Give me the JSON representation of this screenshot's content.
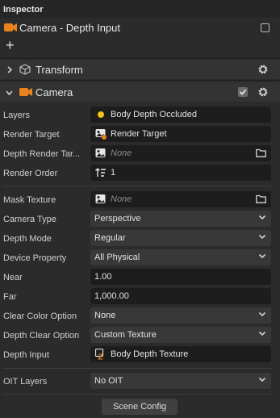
{
  "panel": {
    "title": "Inspector"
  },
  "object": {
    "name": "Camera - Depth Input",
    "add_label": "+"
  },
  "components": {
    "transform": {
      "label": "Transform"
    },
    "camera": {
      "label": "Camera"
    }
  },
  "properties": {
    "layers": {
      "label": "Layers",
      "value": "Body Depth Occluded"
    },
    "render_target": {
      "label": "Render Target",
      "value": "Render Target"
    },
    "depth_render_target": {
      "label": "Depth Render Tar...",
      "value": "None"
    },
    "render_order": {
      "label": "Render Order",
      "value": "1"
    },
    "mask_texture": {
      "label": "Mask Texture",
      "value": "None"
    },
    "camera_type": {
      "label": "Camera Type",
      "value": "Perspective"
    },
    "depth_mode": {
      "label": "Depth Mode",
      "value": "Regular"
    },
    "device_property": {
      "label": "Device Property",
      "value": "All Physical"
    },
    "near": {
      "label": "Near",
      "value": "1.00"
    },
    "far": {
      "label": "Far",
      "value": "1,000.00"
    },
    "clear_color_option": {
      "label": "Clear Color Option",
      "value": "None"
    },
    "depth_clear_option": {
      "label": "Depth Clear Option",
      "value": "Custom Texture"
    },
    "depth_input": {
      "label": "Depth Input",
      "value": "Body Depth Texture"
    },
    "oit_layers": {
      "label": "OIT Layers",
      "value": "No OIT"
    }
  },
  "footer": {
    "scene_config_label": "Scene Config"
  },
  "colors": {
    "accent_orange": "#e8821e",
    "layer_dot": "#f3c31b"
  }
}
